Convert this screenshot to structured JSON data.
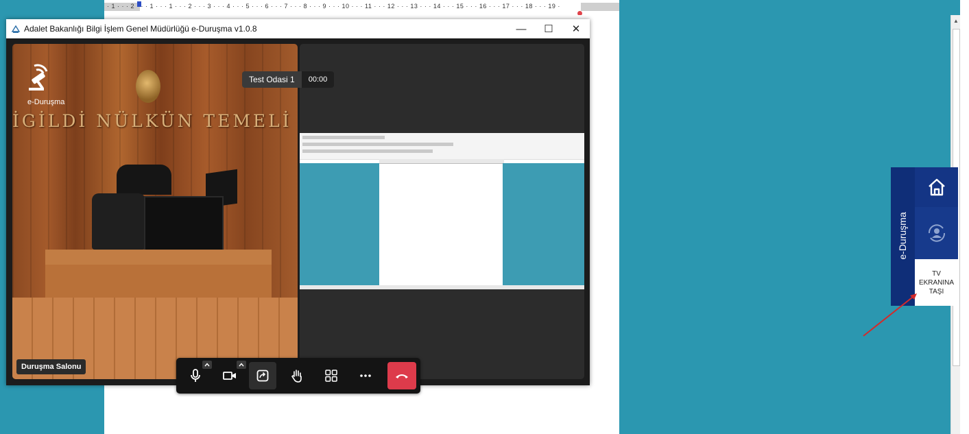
{
  "ruler": {
    "ticks": "· 1 · · · 2 · · · 1 · · · 1 · · · 2 · · · 3 · · · 4 · · · 5 · · · 6 · · · 7 · · · 8 · · · 9 · · · 10 · · · 11 · · · 12 · · · 13 · · · 14 · · · 15 · · · 16 · · · 17 · · · 18 · · · 19 ·"
  },
  "window": {
    "title": "Adalet Bakanlığı Bilgi İşlem Genel Müdürlüğü e-Duruşma v1.0.8",
    "minimize": "—",
    "maximize": "☐",
    "close": "✕"
  },
  "video_left": {
    "logo_text": "e-Duruşma",
    "wall_text": "İGİLDİ NÜLKÜN TEMELİ   DALET",
    "participant_name": "Duruşma Salonu"
  },
  "room": {
    "name": "Test Odasi 1",
    "timer": "00:00"
  },
  "toolbar": {
    "buttons": [
      "microphone",
      "camera",
      "share-screen",
      "raise-hand",
      "layout",
      "more",
      "hang-up"
    ]
  },
  "side_panel": {
    "brand": "e-Duruşma",
    "tv_line1": "TV",
    "tv_line2": "EKRANINA",
    "tv_line3": "TAŞI"
  },
  "colors": {
    "desktop_bg": "#2b97b0",
    "side_band": "#0f2e78",
    "hangup_red": "#dd3b4b",
    "arrow_red": "#d42a2a"
  }
}
